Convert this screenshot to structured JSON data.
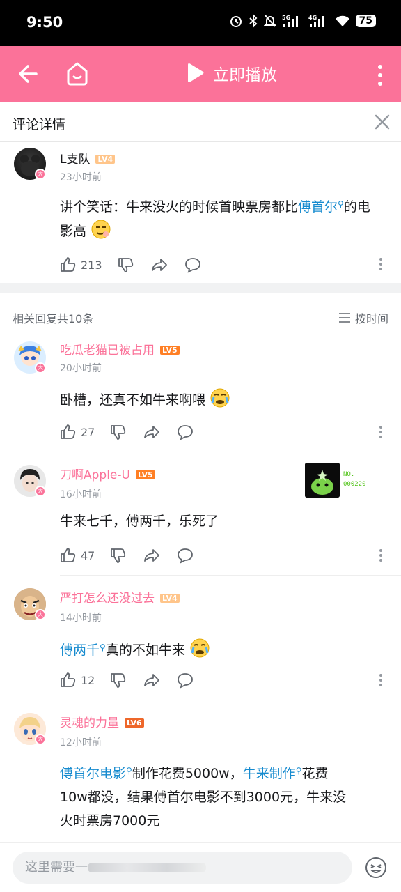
{
  "status": {
    "time": "9:50",
    "battery": "75",
    "network": "5G 4G"
  },
  "appbar": {
    "play_label": "立即播放"
  },
  "header": {
    "title": "评论详情"
  },
  "main_comment": {
    "user": "L支队",
    "level": "LV4",
    "time": "23小时前",
    "text_prefix": "讲个笑话：牛来没火的时候首映票房都比",
    "link": "傅首尔",
    "text_suffix": "的电影高",
    "likes": "213"
  },
  "replies_header": {
    "count_label": "相关回复共10条",
    "sort_label": "按时间"
  },
  "replies": [
    {
      "user": "吃瓜老猫已被占用",
      "level": "LV5",
      "time": "20小时前",
      "text": "卧槽，还真不如牛来啊喂",
      "likes": "27"
    },
    {
      "user": "刀啊Apple-U",
      "level": "LV5",
      "time": "16小时前",
      "text": "牛来七千，傅两千，乐死了",
      "likes": "47",
      "no_label": "NO.",
      "no_value": "000220"
    },
    {
      "user": "严打怎么还没过去",
      "level": "LV4",
      "time": "14小时前",
      "link": "傅两千",
      "text": "真的不如牛来",
      "likes": "12"
    },
    {
      "user": "灵魂的力量",
      "level": "LV6",
      "time": "12小时前",
      "link1": "傅首尔电影",
      "mid1": "制作花费5000w，",
      "link2": "牛来制作",
      "mid2": "花费",
      "line2": "10w都没，结果傅首尔电影不到3000元，牛来没",
      "line3": "火时票房7000元"
    }
  ],
  "input": {
    "placeholder": "这里需要一"
  },
  "colors": {
    "accent": "#fb7299",
    "link": "#178bcf"
  }
}
